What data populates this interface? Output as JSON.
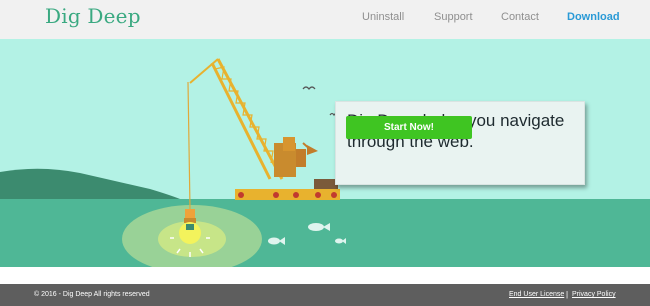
{
  "header": {
    "logo": "Dig Deep",
    "nav": [
      {
        "label": "Uninstall",
        "name": "nav-uninstall"
      },
      {
        "label": "Support",
        "name": "nav-support"
      },
      {
        "label": "Contact",
        "name": "nav-contact"
      },
      {
        "label": "Download",
        "name": "nav-download"
      }
    ]
  },
  "hero": {
    "headline": "Dig Deep helps you navigate through the web.",
    "cta_label": "Start Now!"
  },
  "footer": {
    "copyright": "© 2016 - Dig Deep All rights reserved",
    "links": [
      "End User License",
      "Privacy Policy"
    ],
    "separator": "|"
  },
  "colors": {
    "brand": "#3aa981",
    "nav_active": "#2a9ad6",
    "sky": "#b3f2e5",
    "water": "#4fb796",
    "cta": "#3fc522",
    "crane": "#e8b22e",
    "footer_bg": "#5e5e5e"
  },
  "icons": [
    "lightbulb-icon",
    "fish-icon",
    "bird-icon"
  ]
}
